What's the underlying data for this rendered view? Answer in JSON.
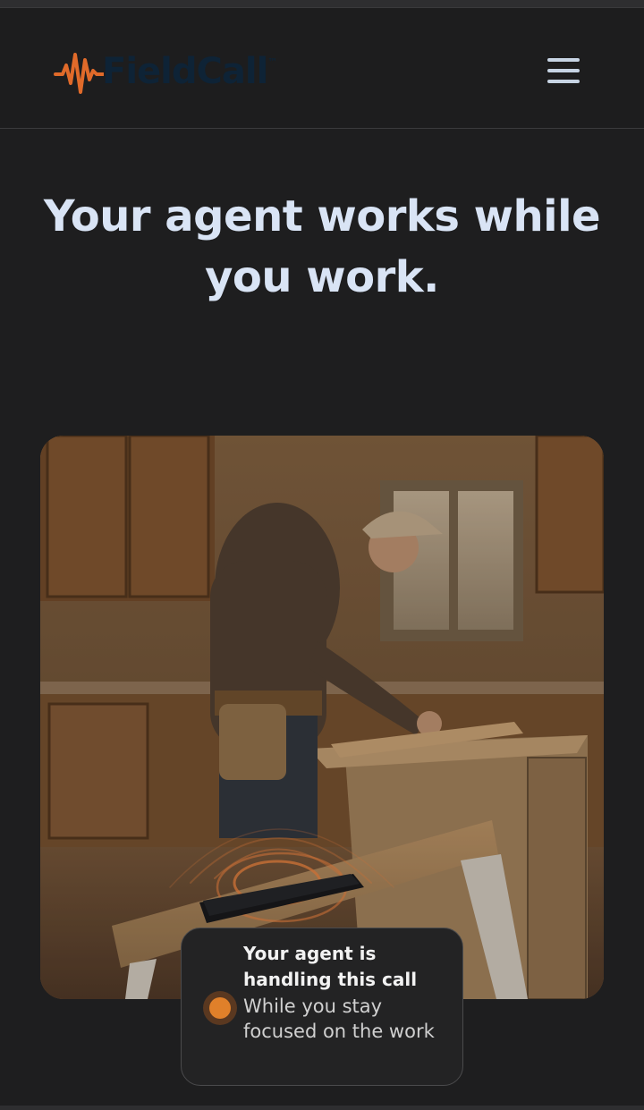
{
  "brand": {
    "name": "FieldCall",
    "trademark": "™",
    "wave_color": "#e06a2a",
    "text_color": "#0e2336"
  },
  "header": {
    "menu_icon": "hamburger-menu-icon"
  },
  "hero": {
    "title": "Your agent works while you work."
  },
  "callout": {
    "title": "Your agent is handling this call",
    "subtitle": "While you stay focused on the work",
    "status_color": "#e0802a"
  },
  "colors": {
    "background": "#1e1e1f",
    "heading": "#d9e4f5"
  }
}
